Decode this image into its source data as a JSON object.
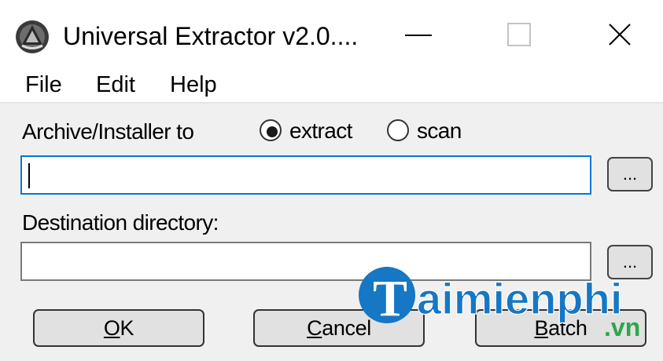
{
  "window": {
    "title": "Universal Extractor v2.0....",
    "controls": {
      "minimize": "minimize-icon",
      "maximize": "maximize-icon",
      "close": "close-icon"
    }
  },
  "menu": {
    "file": "File",
    "edit": "Edit",
    "help": "Help"
  },
  "archive": {
    "label": "Archive/Installer to",
    "value": "",
    "browse_label": "...",
    "mode_options": [
      {
        "label": "extract",
        "selected": true
      },
      {
        "label": "scan",
        "selected": false
      }
    ]
  },
  "destination": {
    "label": "Destination directory:",
    "value": "",
    "browse_label": "..."
  },
  "buttons": {
    "ok": {
      "key": "O",
      "rest": "K"
    },
    "cancel": {
      "key": "C",
      "rest": "ancel"
    },
    "batch": {
      "key": "B",
      "rest": "atch"
    }
  },
  "watermark": {
    "brand": "aimienphi",
    "tld": ".vn"
  },
  "colors": {
    "focus_border": "#0078d7",
    "client_bg": "#f0f0f0",
    "button_bg": "#e1e1e1",
    "watermark_blue": "#1677c4",
    "watermark_green": "#2aa84a"
  }
}
